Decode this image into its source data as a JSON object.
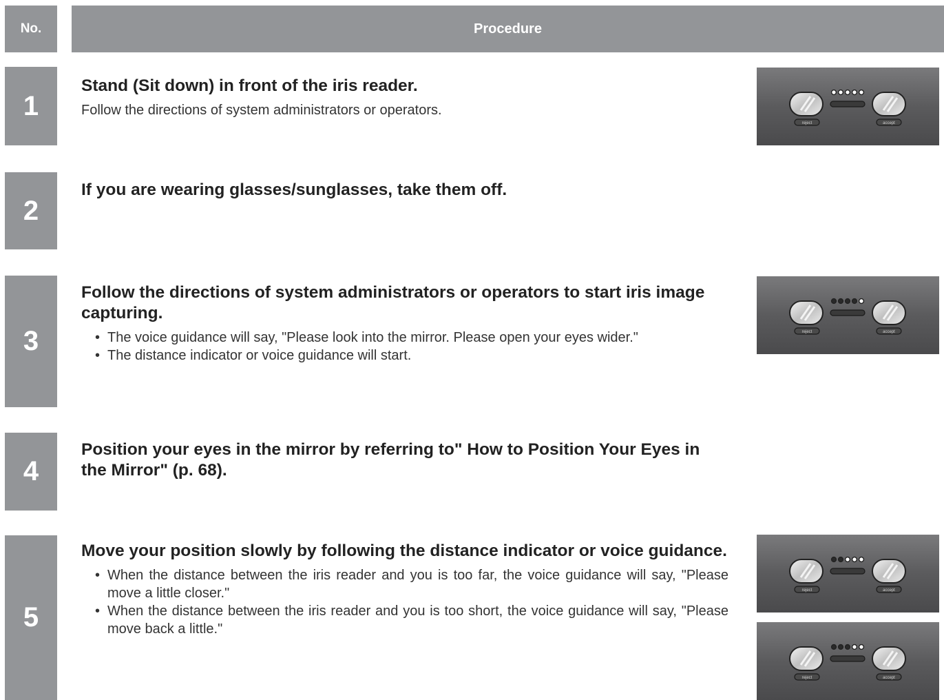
{
  "header": {
    "no": "No.",
    "procedure": "Procedure"
  },
  "steps": [
    {
      "number": "1",
      "title": "Stand (Sit down) in front of the iris reader.",
      "body": "Follow the directions of system administrators or operators."
    },
    {
      "number": "2",
      "title": "If you are wearing glasses/sunglasses, take them off."
    },
    {
      "number": "3",
      "title": "Follow the directions of system administrators or operators to start iris image capturing.",
      "bullets": [
        "The voice guidance will say, \"Please look into the mirror. Please open your eyes wider.\"",
        "The distance indicator or voice guidance will start."
      ]
    },
    {
      "number": "4",
      "title": "Position your eyes in the mirror by referring to\" How to Position Your Eyes in the Mirror\" (p. 68)."
    },
    {
      "number": "5",
      "title": "Move your position slowly by following the distance indicator or voice guidance.",
      "bullets": [
        "When the distance between the iris reader and you is too far, the voice guidance will say, \"Please move a little closer.\"",
        "When the distance between the iris reader and you is too short, the voice guidance will say, \"Please move back a little.\""
      ]
    }
  ],
  "reader": {
    "reject_label": "reject",
    "accept_label": "accept",
    "indicators_lit": [
      0,
      4,
      2,
      3
    ],
    "indicator_count": 5,
    "panel_color": "#5b5b5d"
  }
}
